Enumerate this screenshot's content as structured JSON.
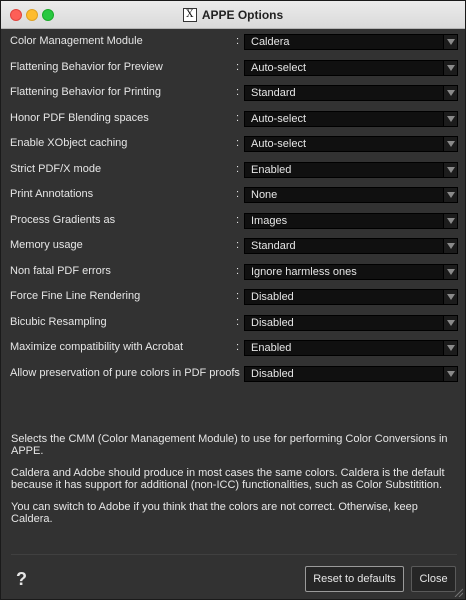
{
  "window": {
    "title": "APPE Options",
    "app_icon_glyph": "X"
  },
  "settings": [
    {
      "label": "Color Management Module",
      "value": "Caldera"
    },
    {
      "label": "Flattening Behavior for Preview",
      "value": "Auto-select"
    },
    {
      "label": "Flattening Behavior for Printing",
      "value": "Standard"
    },
    {
      "label": "Honor PDF Blending spaces",
      "value": "Auto-select"
    },
    {
      "label": "Enable XObject caching",
      "value": "Auto-select"
    },
    {
      "label": "Strict PDF/X mode",
      "value": "Enabled"
    },
    {
      "label": "Print Annotations",
      "value": "None"
    },
    {
      "label": "Process Gradients as",
      "value": "Images"
    },
    {
      "label": "Memory usage",
      "value": "Standard"
    },
    {
      "label": "Non fatal PDF errors",
      "value": "Ignore harmless ones"
    },
    {
      "label": "Force Fine Line Rendering",
      "value": "Disabled"
    },
    {
      "label": "Bicubic Resampling",
      "value": "Disabled"
    },
    {
      "label": "Maximize compatibility with Acrobat",
      "value": "Enabled"
    },
    {
      "label": "Allow preservation of pure colors in PDF proofs",
      "value": "Disabled"
    }
  ],
  "separator": ":",
  "description": {
    "p1": "Selects the CMM (Color Management Module) to use for performing Color Conversions in APPE.",
    "p2": "Caldera and Adobe should produce in most cases the same colors. Caldera is the default because it has support for additional (non-ICC) functionalities, such as Color Substitition.",
    "p3": "You can switch to Adobe if you think that the colors are not correct. Otherwise, keep Caldera."
  },
  "footer": {
    "help_label": "?",
    "reset_label": "Reset to defaults",
    "close_label": "Close"
  },
  "colors": {
    "background": "#323232",
    "field_background": "#101010",
    "text": "#e6e6e6"
  }
}
